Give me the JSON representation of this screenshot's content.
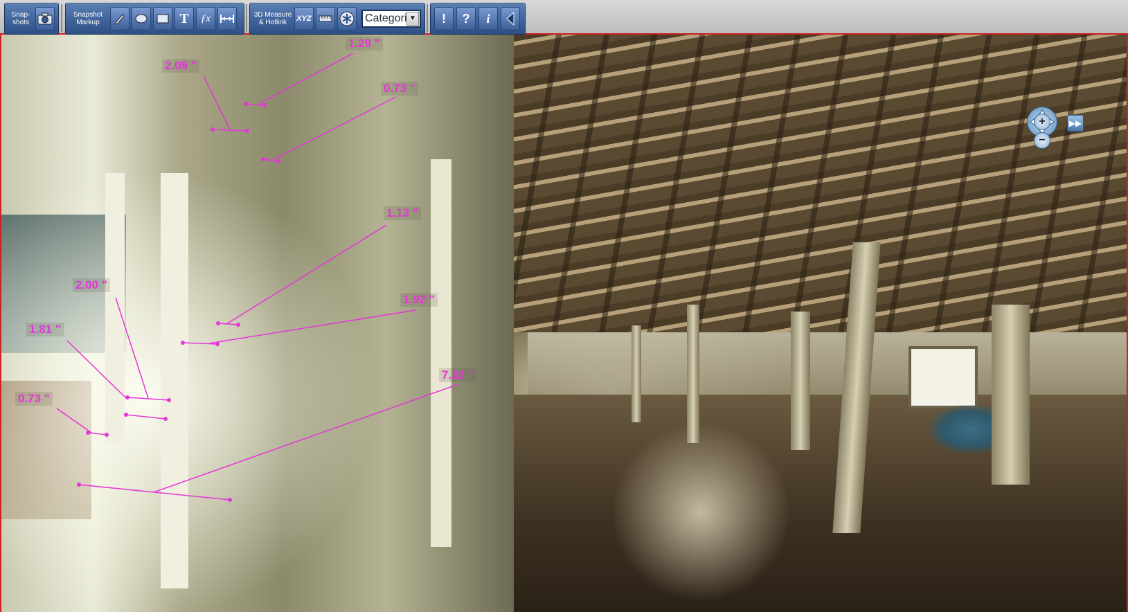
{
  "toolbar": {
    "snapshots_label": "Snap-\nshots",
    "snapshot_markup_label": "Snapshot\nMarkup",
    "measure_hotlink_label": "3D Measure\n& Hotlink",
    "xyz_label": "XYZ",
    "categories_value": "Categorie",
    "icons": [
      "camera-icon",
      "pencil-icon",
      "ellipse-icon",
      "rectangle-icon",
      "text-icon",
      "formula-icon",
      "dimension-icon",
      "ruler-icon",
      "snowflake-icon",
      "exclamation-icon",
      "question-icon",
      "info-icon",
      "collapse-left-icon"
    ]
  },
  "measurements": [
    {
      "id": "m1",
      "label": "1.29 \""
    },
    {
      "id": "m2",
      "label": "2.09 \""
    },
    {
      "id": "m3",
      "label": "0.73 \""
    },
    {
      "id": "m4",
      "label": "1.13 \""
    },
    {
      "id": "m5",
      "label": "2.00 \""
    },
    {
      "id": "m6",
      "label": "1.92 \""
    },
    {
      "id": "m7",
      "label": "1.81 \""
    },
    {
      "id": "m8",
      "label": "7.32 \""
    },
    {
      "id": "m9",
      "label": "0.73 \""
    }
  ],
  "colors": {
    "measure": "#e535d8",
    "toolbar_blue": "#3b5f99",
    "frame_red": "#cc2222"
  },
  "nav": {
    "zoom_in_label": "+",
    "zoom_out_label": "−",
    "forward_label": "▶▶"
  }
}
